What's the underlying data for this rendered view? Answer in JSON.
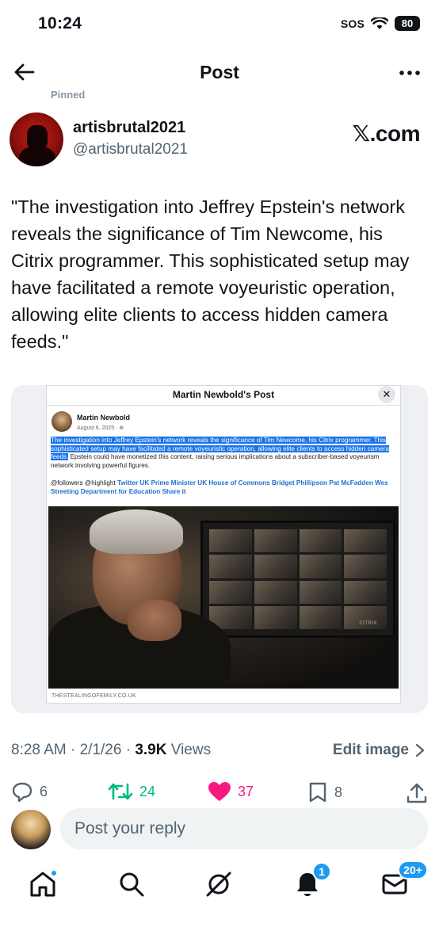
{
  "status_bar": {
    "time": "10:24",
    "sos": "SOS",
    "battery": "80"
  },
  "header": {
    "title": "Post"
  },
  "pinned_label": "Pinned",
  "author": {
    "name": "artisbrutal2021",
    "handle": "@artisbrutal2021",
    "badge": "𝕏.com"
  },
  "post": {
    "text": "\"The  investigation into Jeffrey Epstein's network reveals the significance  of Tim Newcome, his Citrix programmer. This sophisticated setup may have  facilitated a remote voyeuristic operation, allowing elite clients to  access hidden camera feeds.\""
  },
  "embed": {
    "title": "Martin Newbold's Post",
    "close": "✕",
    "author": "Martin Newbold",
    "date": "August 6, 2025 · ⊕",
    "highlighted_text": "The investigation into Jeffrey Epstein's network reveals the significance of Tim Newcome, his Citrix programmer. This sophisticated setup may have facilitated a remote voyeuristic operation, allowing elite clients to access hidden camera feeds.",
    "rest_text": " Epstein could have monetized this content, raising serious implications about a subscriber-based voyeurism network involving powerful figures.",
    "tags_prefix": "@followers @highlight ",
    "tags_links": "Twitter UK Prime Minister UK House of Commons Bridget Phillipson Pat McFadden Wes Streeting Department for Education Share it",
    "monitor_brand": "CITRIX",
    "footer": "THESTEALINGOFEMILY.CO.UK"
  },
  "meta": {
    "time": "8:28 AM",
    "date": "2/1/26",
    "views_count": "3.9K",
    "views_label": " Views",
    "edit_image": "Edit image"
  },
  "actions": {
    "replies": "6",
    "reposts": "24",
    "likes": "37",
    "bookmarks": "8"
  },
  "reply": {
    "placeholder": "Post your reply"
  },
  "nav": {
    "notifications_badge": "1",
    "messages_badge": "20+"
  },
  "colors": {
    "repost": "#00ba7c",
    "like": "#f91880",
    "accent": "#1d9bf0"
  },
  "icons": [
    "back-arrow-icon",
    "more-icon",
    "reply-icon",
    "repost-icon",
    "heart-icon",
    "bookmark-icon",
    "share-icon",
    "home-icon",
    "search-icon",
    "grok-icon",
    "bell-icon",
    "mail-icon"
  ]
}
